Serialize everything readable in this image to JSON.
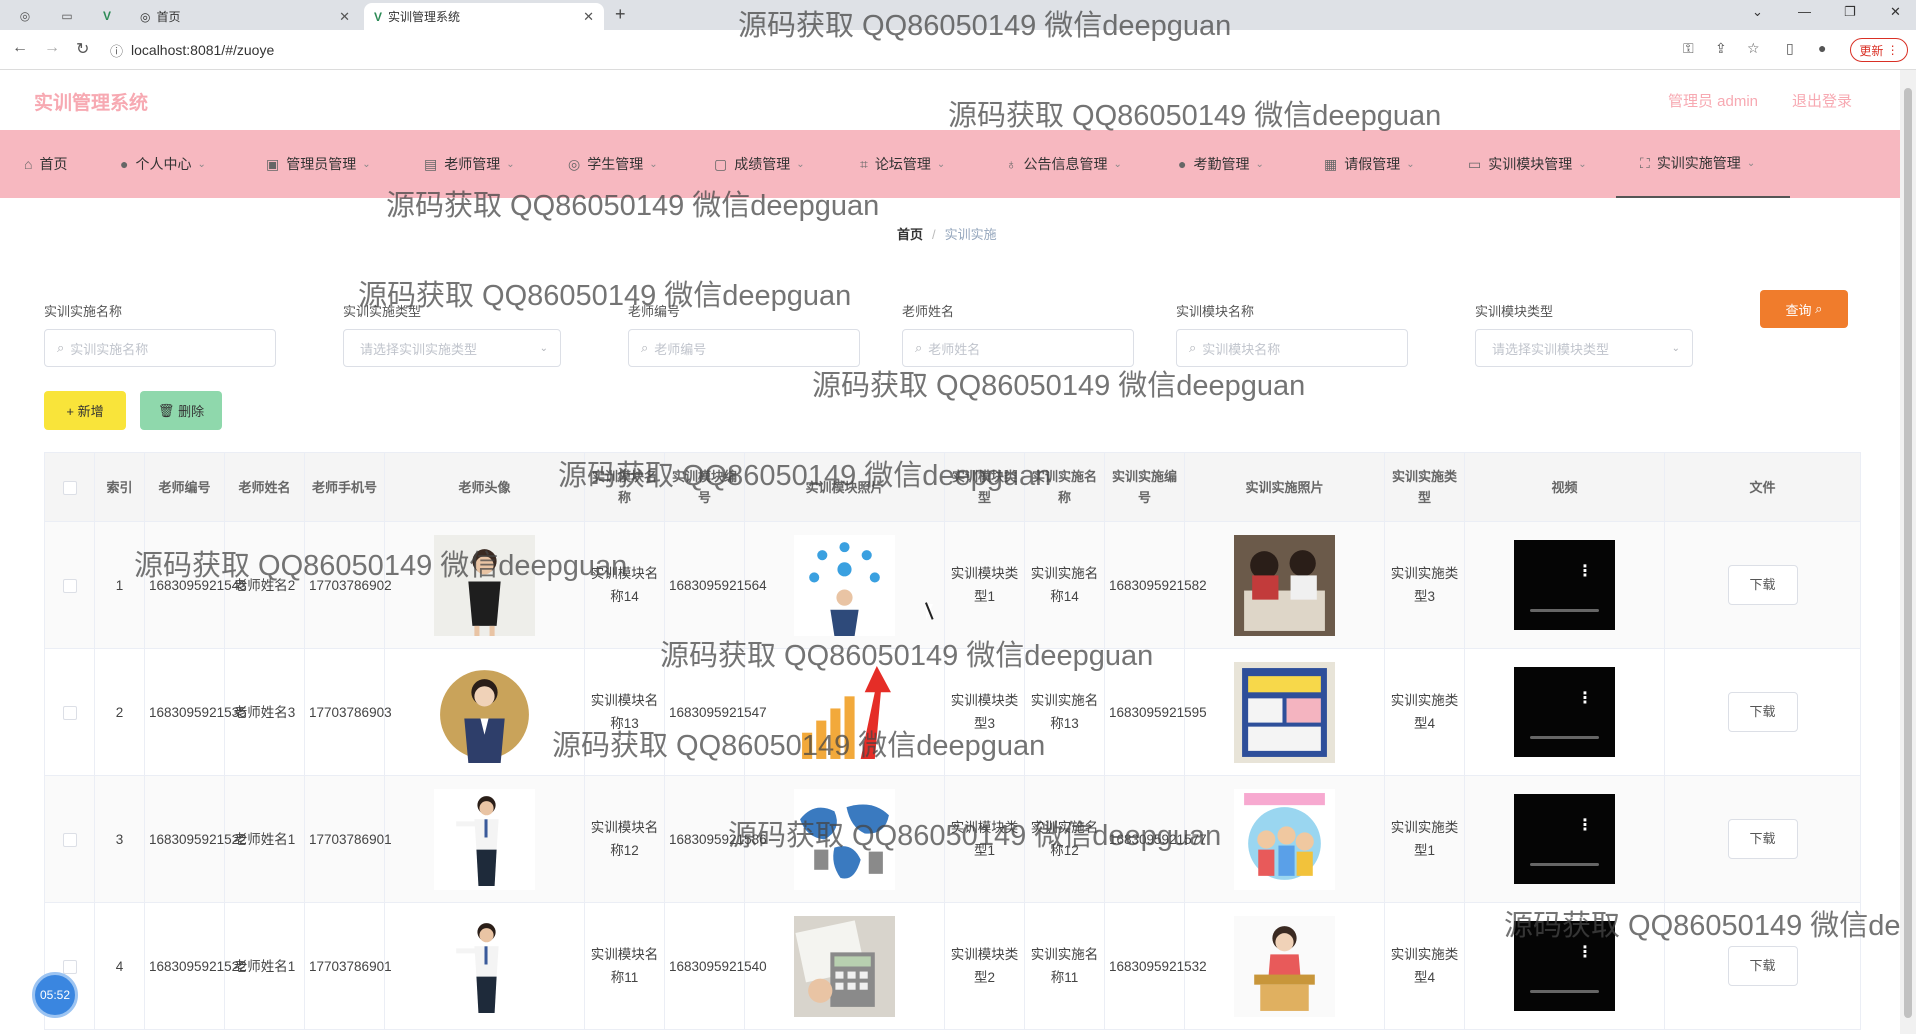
{
  "browser": {
    "tabs": [
      {
        "label": "首页"
      },
      {
        "label": "实训管理系统"
      }
    ],
    "url": "localhost:8081/#/zuoye",
    "update_label": "更新"
  },
  "app": {
    "title": "实训管理系统",
    "user": "管理员 admin",
    "logout": "退出登录"
  },
  "menu": {
    "items": [
      {
        "label": "首页"
      },
      {
        "label": "个人中心"
      },
      {
        "label": "管理员管理"
      },
      {
        "label": "老师管理"
      },
      {
        "label": "学生管理"
      },
      {
        "label": "成绩管理"
      },
      {
        "label": "论坛管理"
      },
      {
        "label": "公告信息管理"
      },
      {
        "label": "考勤管理"
      },
      {
        "label": "请假管理"
      },
      {
        "label": "实训模块管理"
      },
      {
        "label": "实训实施管理"
      }
    ]
  },
  "breadcrumb": {
    "home": "首页",
    "sep": "/",
    "current": "实训实施"
  },
  "search": {
    "fields": [
      {
        "label": "实训实施名称",
        "placeholder": "实训实施名称"
      },
      {
        "label": "实训实施类型",
        "placeholder": "请选择实训实施类型"
      },
      {
        "label": "老师编号",
        "placeholder": "老师编号"
      },
      {
        "label": "老师姓名",
        "placeholder": "老师姓名"
      },
      {
        "label": "实训模块名称",
        "placeholder": "实训模块名称"
      },
      {
        "label": "实训模块类型",
        "placeholder": "请选择实训模块类型"
      }
    ],
    "query_label": "查询"
  },
  "actions": {
    "add_label": "+ 新增",
    "delete_label": "删除"
  },
  "table": {
    "headers": [
      "索引",
      "老师编号",
      "老师姓名",
      "老师手机号",
      "老师头像",
      "实训模块名称",
      "实训模块编号",
      "实训模块照片",
      "实训模块类型",
      "实训实施名称",
      "实训实施编号",
      "实训实施照片",
      "实训实施类型",
      "视频",
      "文件"
    ],
    "download_label": "下载",
    "rows": [
      {
        "index": "1",
        "teacher_no": "1683095921543",
        "teacher_name": "老师姓名2",
        "phone": "17703786902",
        "module_name": "实训模块名称14",
        "module_no": "1683095921564",
        "module_type": "实训模块类型1",
        "impl_name": "实训实施名称14",
        "impl_no": "1683095921582",
        "impl_type": "实训实施类型3"
      },
      {
        "index": "2",
        "teacher_no": "1683095921535",
        "teacher_name": "老师姓名3",
        "phone": "17703786903",
        "module_name": "实训模块名称13",
        "module_no": "1683095921547",
        "module_type": "实训模块类型3",
        "impl_name": "实训实施名称13",
        "impl_no": "1683095921595",
        "impl_type": "实训实施类型4"
      },
      {
        "index": "3",
        "teacher_no": "1683095921522",
        "teacher_name": "老师姓名1",
        "phone": "17703786901",
        "module_name": "实训模块名称12",
        "module_no": "1683095921586",
        "module_type": "实训模块类型1",
        "impl_name": "实训实施名称12",
        "impl_no": "1683095921577",
        "impl_type": "实训实施类型1"
      },
      {
        "index": "4",
        "teacher_no": "1683095921522",
        "teacher_name": "老师姓名1",
        "phone": "17703786901",
        "module_name": "实训模块名称11",
        "module_no": "1683095921540",
        "module_type": "实训模块类型2",
        "impl_name": "实训实施名称11",
        "impl_no": "1683095921532",
        "impl_type": "实训实施类型4"
      }
    ]
  },
  "clock": "05:52",
  "watermark": "源码获取 QQ86050149 微信deepguan"
}
